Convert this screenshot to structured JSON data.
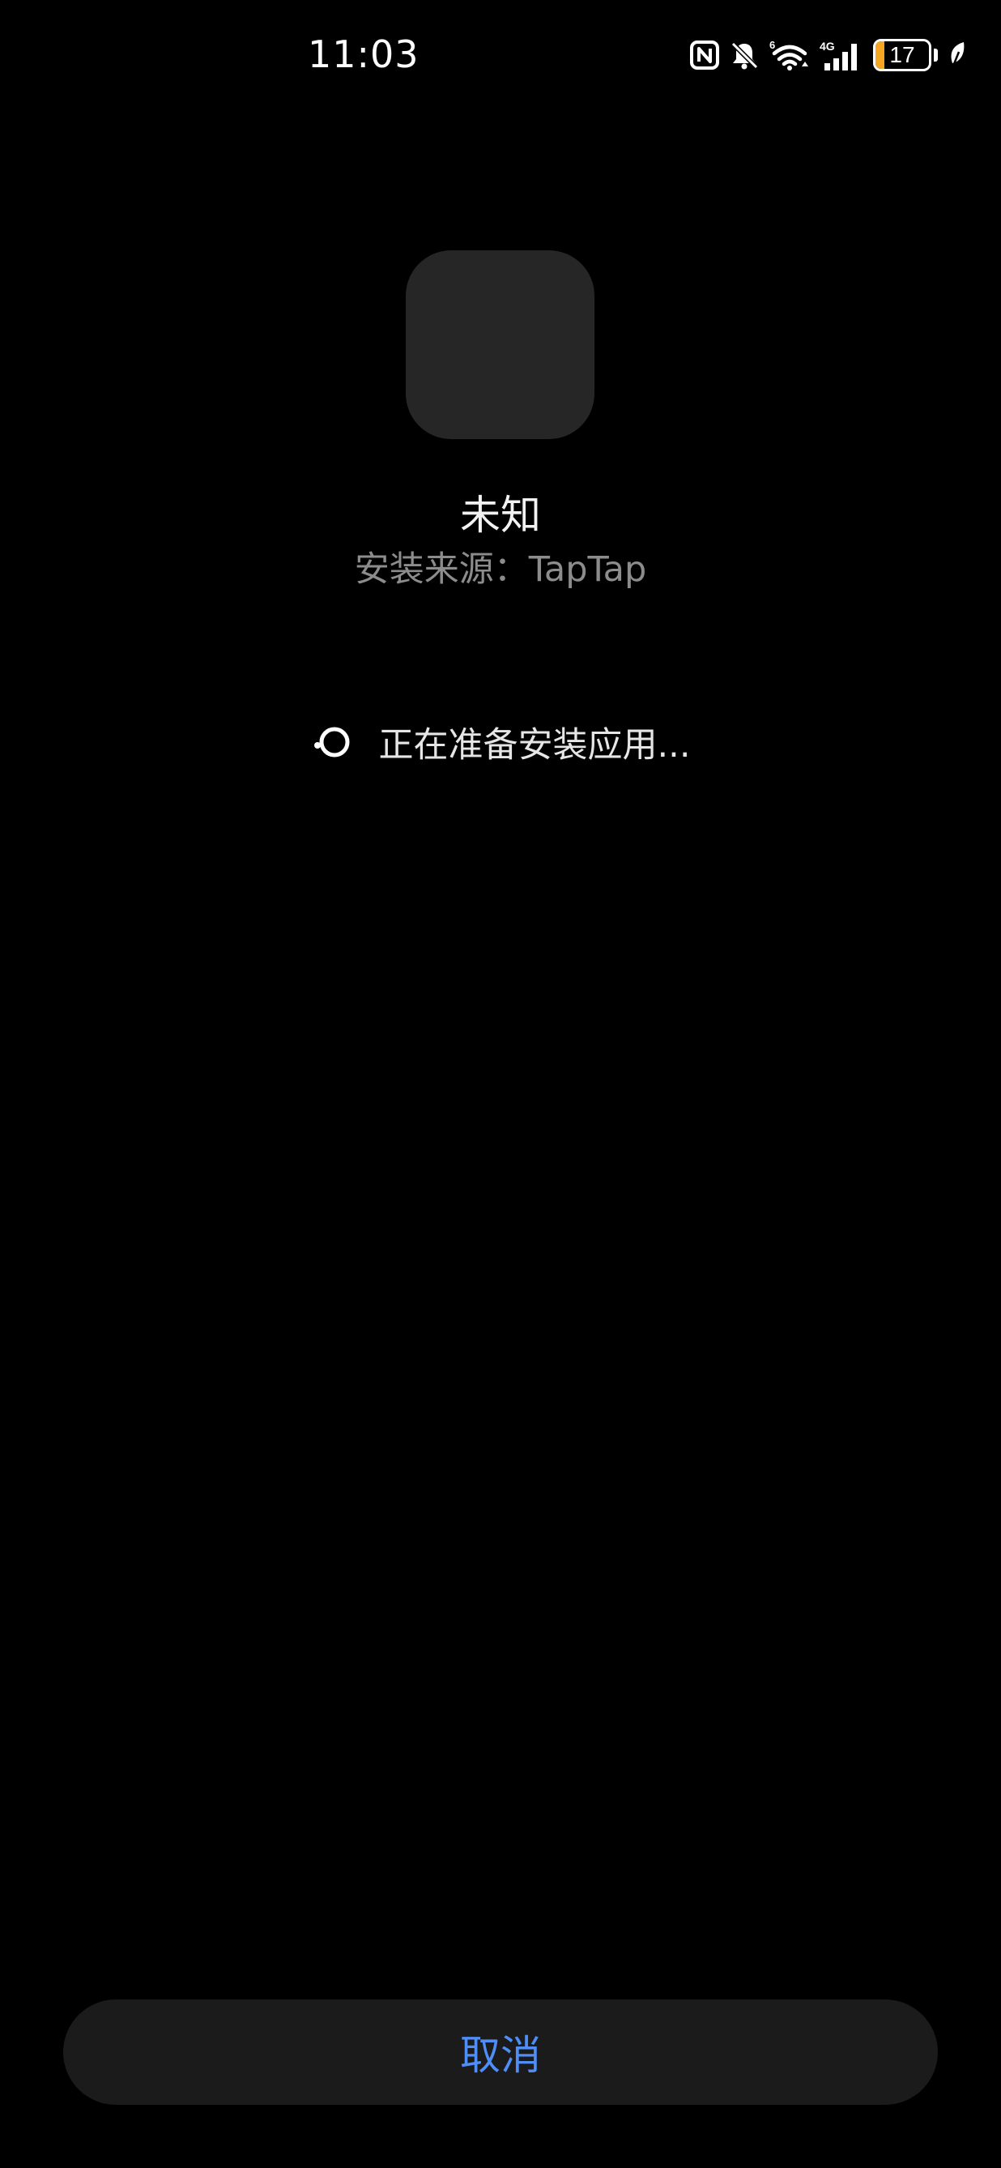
{
  "status_bar": {
    "time": "11:03",
    "icons": [
      "nfc-icon",
      "mute-bell-icon",
      "wifi-6-icon",
      "signal-4g-icon",
      "battery-icon",
      "leaf-icon"
    ],
    "wifi_badge": "6",
    "cell_badge": "4G",
    "battery_level": "17",
    "battery_fraction": 0.17,
    "battery_color": "#f5a623"
  },
  "app": {
    "name": "未知",
    "source": "安装来源：TapTap"
  },
  "progress": {
    "text": "正在准备安装应用..."
  },
  "actions": {
    "cancel_label": "取消",
    "accent_color": "#4f8ef7"
  }
}
